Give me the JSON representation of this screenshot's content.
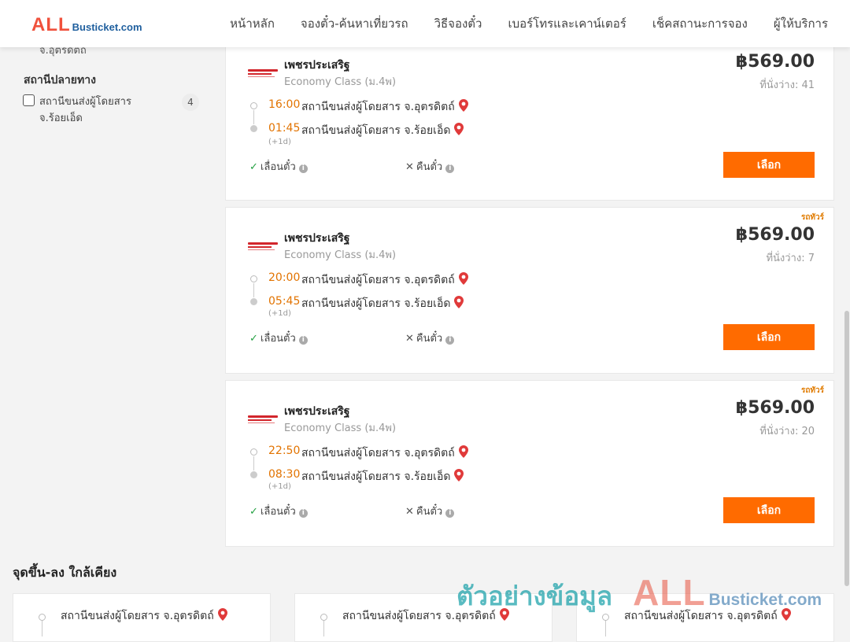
{
  "brand": {
    "logo_main": "ALL",
    "logo_sub": "Busticket.com"
  },
  "nav": [
    "หน้าหลัก",
    "จองตั๋ว-ค้นหาเที่ยวรถ",
    "วิธีจองตั๋ว",
    "เบอร์โทรและเคาน์เตอร์",
    "เช็คสถานะการจอง",
    "ผู้ให้บริการ"
  ],
  "sidebar": {
    "cut_label": "จ.อุตรดิตถ์",
    "destination_title": "สถานีปลายทาง",
    "destination_items": [
      {
        "label": "สถานีขนส่งผู้โดยสาร จ.ร้อยเอ็ด",
        "count": "4",
        "checked": false
      }
    ]
  },
  "trips": [
    {
      "operator": "เพชรประเสริฐ",
      "class": "Economy Class (ม.4พ)",
      "price": "฿569.00",
      "seats": "ที่นั่งว่าง: 41",
      "badge": "",
      "depart_time": "16:00",
      "depart_place": "สถานีขนส่งผู้โดยสาร จ.อุตรดิตถ์",
      "arrive_time": "01:45",
      "arrive_place": "สถานีขนส่งผู้โดยสาร จ.ร้อยเอ็ด",
      "next_day": "(+1d)",
      "reschedule": "เลื่อนตั๋ว",
      "refund": "คืนตั๋ว",
      "select": "เลือก"
    },
    {
      "operator": "เพชรประเสริฐ",
      "class": "Economy Class (ม.4พ)",
      "price": "฿569.00",
      "seats": "ที่นั่งว่าง: 7",
      "badge": "รถทัวร์",
      "depart_time": "20:00",
      "depart_place": "สถานีขนส่งผู้โดยสาร จ.อุตรดิตถ์",
      "arrive_time": "05:45",
      "arrive_place": "สถานีขนส่งผู้โดยสาร จ.ร้อยเอ็ด",
      "next_day": "(+1d)",
      "reschedule": "เลื่อนตั๋ว",
      "refund": "คืนตั๋ว",
      "select": "เลือก"
    },
    {
      "operator": "เพชรประเสริฐ",
      "class": "Economy Class (ม.4พ)",
      "price": "฿569.00",
      "seats": "ที่นั่งว่าง: 20",
      "badge": "รถทัวร์",
      "depart_time": "22:50",
      "depart_place": "สถานีขนส่งผู้โดยสาร จ.อุตรดิตถ์",
      "arrive_time": "08:30",
      "arrive_place": "สถานีขนส่งผู้โดยสาร จ.ร้อยเอ็ด",
      "next_day": "(+1d)",
      "reschedule": "เลื่อนตั๋ว",
      "refund": "คืนตั๋ว",
      "select": "เลือก"
    }
  ],
  "nearby": {
    "title": "จุดขึ้น-ลง ใกล้เคียง",
    "items": [
      "สถานีขนส่งผู้โดยสาร จ.อุตรดิตถ์",
      "สถานีขนส่งผู้โดยสาร จ.อุตรดิตถ์",
      "สถานีขนส่งผู้โดยสาร จ.อุตรดิตถ์"
    ]
  },
  "watermark": {
    "thai": "ตัวอย่างข้อมูล",
    "all": "ALL",
    "site": "Busticket.com"
  },
  "colors": {
    "accent": "#ff6b00",
    "time": "#e27300",
    "pin": "#e03a3a",
    "check": "#23a042"
  }
}
